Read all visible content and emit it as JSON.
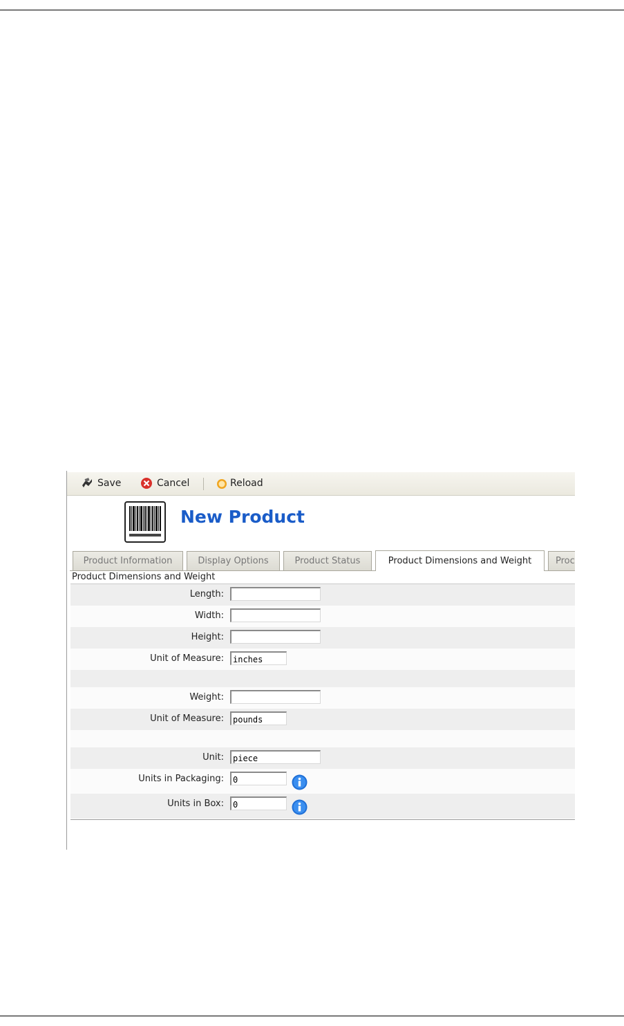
{
  "toolbar": {
    "save_label": "Save",
    "cancel_label": "Cancel",
    "reload_label": "Reload"
  },
  "page": {
    "title": "New Product"
  },
  "tabs": [
    {
      "label": "Product Information",
      "active": false
    },
    {
      "label": "Display Options",
      "active": false
    },
    {
      "label": "Product Status",
      "active": false
    },
    {
      "label": "Product Dimensions and Weight",
      "active": true
    },
    {
      "label": "Proc",
      "active": false
    }
  ],
  "section": {
    "title": "Product Dimensions and Weight"
  },
  "form": {
    "length": {
      "label": "Length:",
      "value": ""
    },
    "width": {
      "label": "Width:",
      "value": ""
    },
    "height": {
      "label": "Height:",
      "value": ""
    },
    "dim_unit": {
      "label": "Unit of Measure:",
      "value": "inches"
    },
    "weight": {
      "label": "Weight:",
      "value": ""
    },
    "weight_unit": {
      "label": "Unit of Measure:",
      "value": "pounds"
    },
    "unit": {
      "label": "Unit:",
      "value": "piece"
    },
    "units_packaging": {
      "label": "Units in Packaging:",
      "value": "0"
    },
    "units_box": {
      "label": "Units in Box:",
      "value": "0"
    }
  },
  "colors": {
    "title": "#1a5cc8",
    "info_icon": "#1f6fd6",
    "cancel_icon": "#d9312b",
    "reload_icon": "#f0a520"
  },
  "icons": [
    "save-icon",
    "cancel-icon",
    "reload-icon",
    "barcode-icon",
    "info-icon"
  ]
}
